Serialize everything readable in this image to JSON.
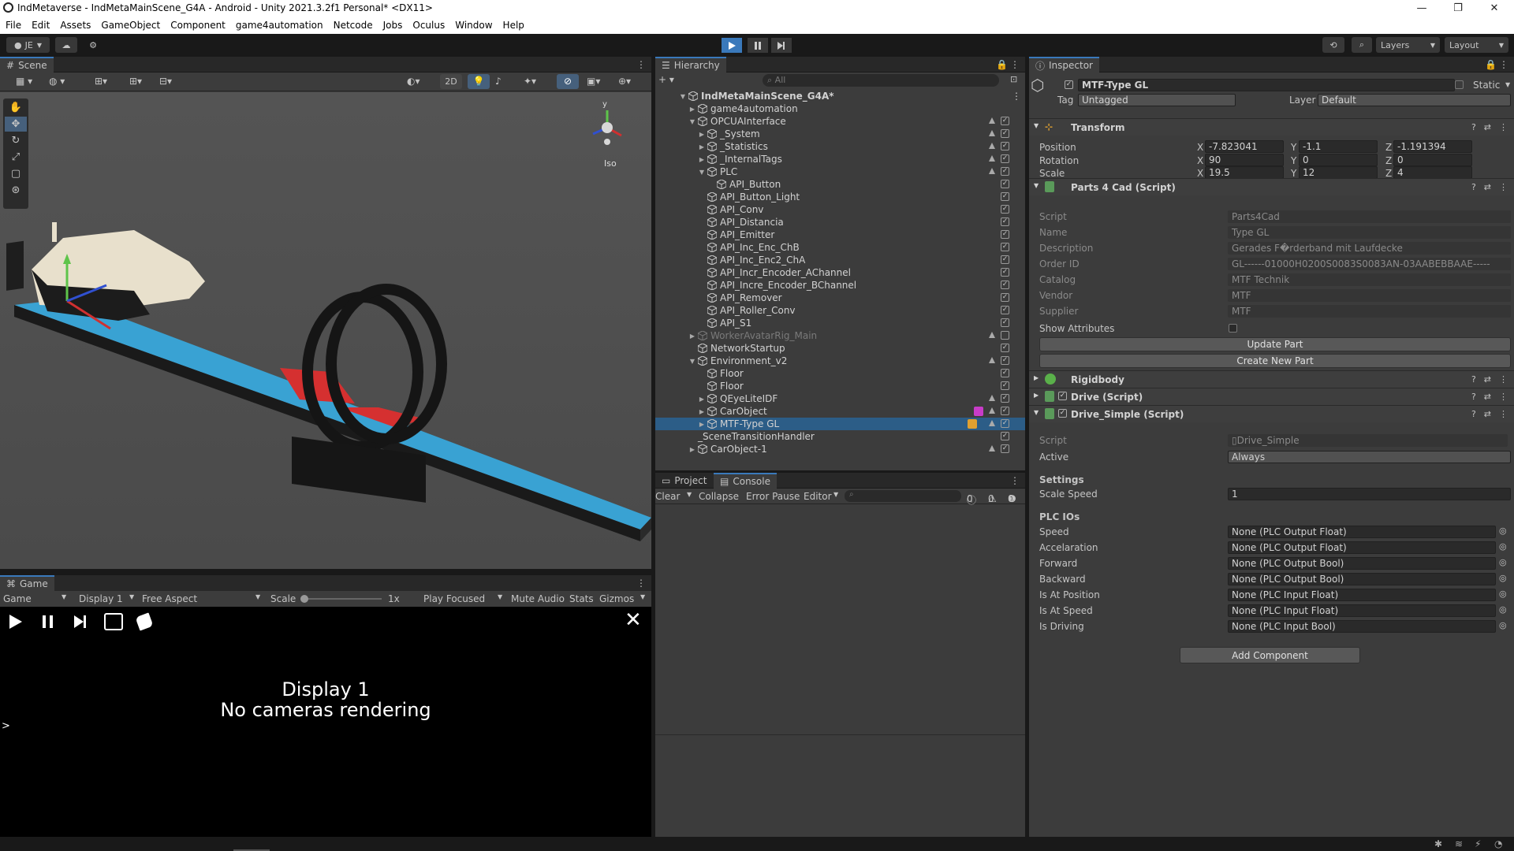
{
  "window": {
    "title": "IndMetaverse - IndMetaMainScene_G4A - Android - Unity 2021.3.2f1 Personal* <DX11>",
    "controls": [
      "—",
      "❐",
      "✕"
    ]
  },
  "menu": [
    "File",
    "Edit",
    "Assets",
    "GameObject",
    "Component",
    "game4automation",
    "Netcode",
    "Jobs",
    "Oculus",
    "Window",
    "Help"
  ],
  "toolbar": {
    "account": "JE",
    "layers": "Layers",
    "layout": "Layout"
  },
  "scene": {
    "tab": "Scene",
    "mode_2d": "2D",
    "iso_label": "Iso",
    "gizmo_y": "y"
  },
  "game": {
    "tab": "Game",
    "view_select": "Game",
    "display": "Display 1",
    "aspect": "Free Aspect",
    "scale_label": "Scale",
    "scale_value": "1x",
    "play_mode": "Play Focused",
    "mute": "Mute Audio",
    "stats": "Stats",
    "gizmos": "Gizmos",
    "message_line1": "Display 1",
    "message_line2": "No cameras rendering",
    "prompt": ">"
  },
  "hierarchy": {
    "tab": "Hierarchy",
    "search_placeholder": "All",
    "rows": [
      {
        "name": "IndMetaMainScene_G4A*",
        "indent": 0,
        "arrow": "▼",
        "scene": true
      },
      {
        "name": "game4automation",
        "indent": 1,
        "arrow": "▶"
      },
      {
        "name": "OPCUAInterface",
        "indent": 1,
        "arrow": "▼",
        "warn": true,
        "check": true
      },
      {
        "name": "_System",
        "indent": 2,
        "arrow": "▶",
        "warn": true,
        "check": true
      },
      {
        "name": "_Statistics",
        "indent": 2,
        "arrow": "▶",
        "warn": true,
        "check": true
      },
      {
        "name": "_InternalTags",
        "indent": 2,
        "arrow": "▶",
        "warn": true,
        "check": true
      },
      {
        "name": "PLC",
        "indent": 2,
        "arrow": "▼",
        "warn": true,
        "check": true
      },
      {
        "name": "API_Button",
        "indent": 3,
        "arrow": "",
        "check": true
      },
      {
        "name": "API_Button_Light",
        "indent": 2,
        "arrow": "",
        "check": true
      },
      {
        "name": "API_Conv",
        "indent": 2,
        "arrow": "",
        "check": true
      },
      {
        "name": "API_Distancia",
        "indent": 2,
        "arrow": "",
        "check": true
      },
      {
        "name": "API_Emitter",
        "indent": 2,
        "arrow": "",
        "check": true
      },
      {
        "name": "API_Inc_Enc_ChB",
        "indent": 2,
        "arrow": "",
        "check": true
      },
      {
        "name": "API_Inc_Enc2_ChA",
        "indent": 2,
        "arrow": "",
        "check": true
      },
      {
        "name": "API_Incr_Encoder_AChannel",
        "indent": 2,
        "arrow": "",
        "check": true
      },
      {
        "name": "API_Incre_Encoder_BChannel",
        "indent": 2,
        "arrow": "",
        "check": true
      },
      {
        "name": "API_Remover",
        "indent": 2,
        "arrow": "",
        "check": true
      },
      {
        "name": "API_Roller_Conv",
        "indent": 2,
        "arrow": "",
        "check": true
      },
      {
        "name": "API_S1",
        "indent": 2,
        "arrow": "",
        "check": true
      },
      {
        "name": "WorkerAvatarRig_Main",
        "indent": 1,
        "arrow": "▶",
        "warn": true,
        "dim": true,
        "check": false
      },
      {
        "name": "NetworkStartup",
        "indent": 1,
        "arrow": "",
        "check": true
      },
      {
        "name": "Environment_v2",
        "indent": 1,
        "arrow": "▼",
        "warn": true,
        "check": true
      },
      {
        "name": "Floor",
        "indent": 2,
        "arrow": "",
        "check": true
      },
      {
        "name": "Floor",
        "indent": 2,
        "arrow": "",
        "check": true
      },
      {
        "name": "QEyeLiteIDF",
        "indent": 2,
        "arrow": "▶",
        "warn": true,
        "check": true
      },
      {
        "name": "CarObject",
        "indent": 2,
        "arrow": "▶",
        "warn": true,
        "check": true,
        "badge": "pink"
      },
      {
        "name": "MTF-Type GL",
        "indent": 2,
        "arrow": "▶",
        "warn": true,
        "check": true,
        "badge": "orange",
        "selected": true
      },
      {
        "name": "_SceneTransitionHandler",
        "indent": 1,
        "arrow": "",
        "check": true,
        "nocube": true
      },
      {
        "name": "CarObject-1",
        "indent": 1,
        "arrow": "▶",
        "warn": true,
        "check": true
      }
    ]
  },
  "console": {
    "tab_project": "Project",
    "tab_console": "Console",
    "clear": "Clear",
    "collapse": "Collapse",
    "error_pause": "Error Pause",
    "editor": "Editor",
    "count_info": "0",
    "count_warn": "0",
    "count_error": "0"
  },
  "inspector": {
    "tab": "Inspector",
    "object_name": "MTF-Type GL",
    "static_label": "Static",
    "tag_label": "Tag",
    "tag_value": "Untagged",
    "layer_label": "Layer",
    "layer_value": "Default",
    "transform": {
      "title": "Transform",
      "position_label": "Position",
      "rotation_label": "Rotation",
      "scale_label": "Scale",
      "position": {
        "x": "-7.823041",
        "y": "-1.1",
        "z": "-1.191394"
      },
      "rotation": {
        "x": "90",
        "y": "0",
        "z": "0"
      },
      "scale": {
        "x": "19.5",
        "y": "12",
        "z": "4"
      }
    },
    "parts4cad": {
      "title": "Parts 4 Cad (Script)",
      "fields": [
        {
          "label": "Script",
          "value": "Parts4Cad"
        },
        {
          "label": "Name",
          "value": "Type GL"
        },
        {
          "label": "Description",
          "value": "Gerades F�rderband mit Laufdecke"
        },
        {
          "label": "Order ID",
          "value": "GL------01000H0200S0083S0083AN-03AABEBBAAE-----"
        },
        {
          "label": "Catalog",
          "value": "MTF Technik"
        },
        {
          "label": "Vendor",
          "value": "MTF"
        },
        {
          "label": "Supplier",
          "value": "MTF"
        }
      ],
      "show_attributes": "Show Attributes",
      "update_button": "Update Part",
      "create_button": "Create New Part"
    },
    "rigidbody": {
      "title": "Rigidbody"
    },
    "drive": {
      "title": "Drive (Script)"
    },
    "drive_simple": {
      "title": "Drive_Simple (Script)",
      "script_label": "Script",
      "script_value": "Drive_Simple",
      "active_label": "Active",
      "active_value": "Always",
      "settings_header": "Settings",
      "scale_speed_label": "Scale Speed",
      "scale_speed_value": "1",
      "plc_header": "PLC IOs",
      "ios": [
        {
          "label": "Speed",
          "value": "None (PLC Output Float)"
        },
        {
          "label": "Accelaration",
          "value": "None (PLC Output Float)"
        },
        {
          "label": "Forward",
          "value": "None (PLC Output Bool)"
        },
        {
          "label": "Backward",
          "value": "None (PLC Output Bool)"
        },
        {
          "label": "Is At Position",
          "value": "None (PLC Input Float)"
        },
        {
          "label": "Is At Speed",
          "value": "None (PLC Input Float)"
        },
        {
          "label": "Is Driving",
          "value": "None (PLC Input Bool)"
        }
      ]
    },
    "add_component": "Add Component"
  },
  "colors": {
    "accent": "#3a79bb",
    "conveyor": "#3aa0d0",
    "selected_row": "#2c5d87"
  }
}
